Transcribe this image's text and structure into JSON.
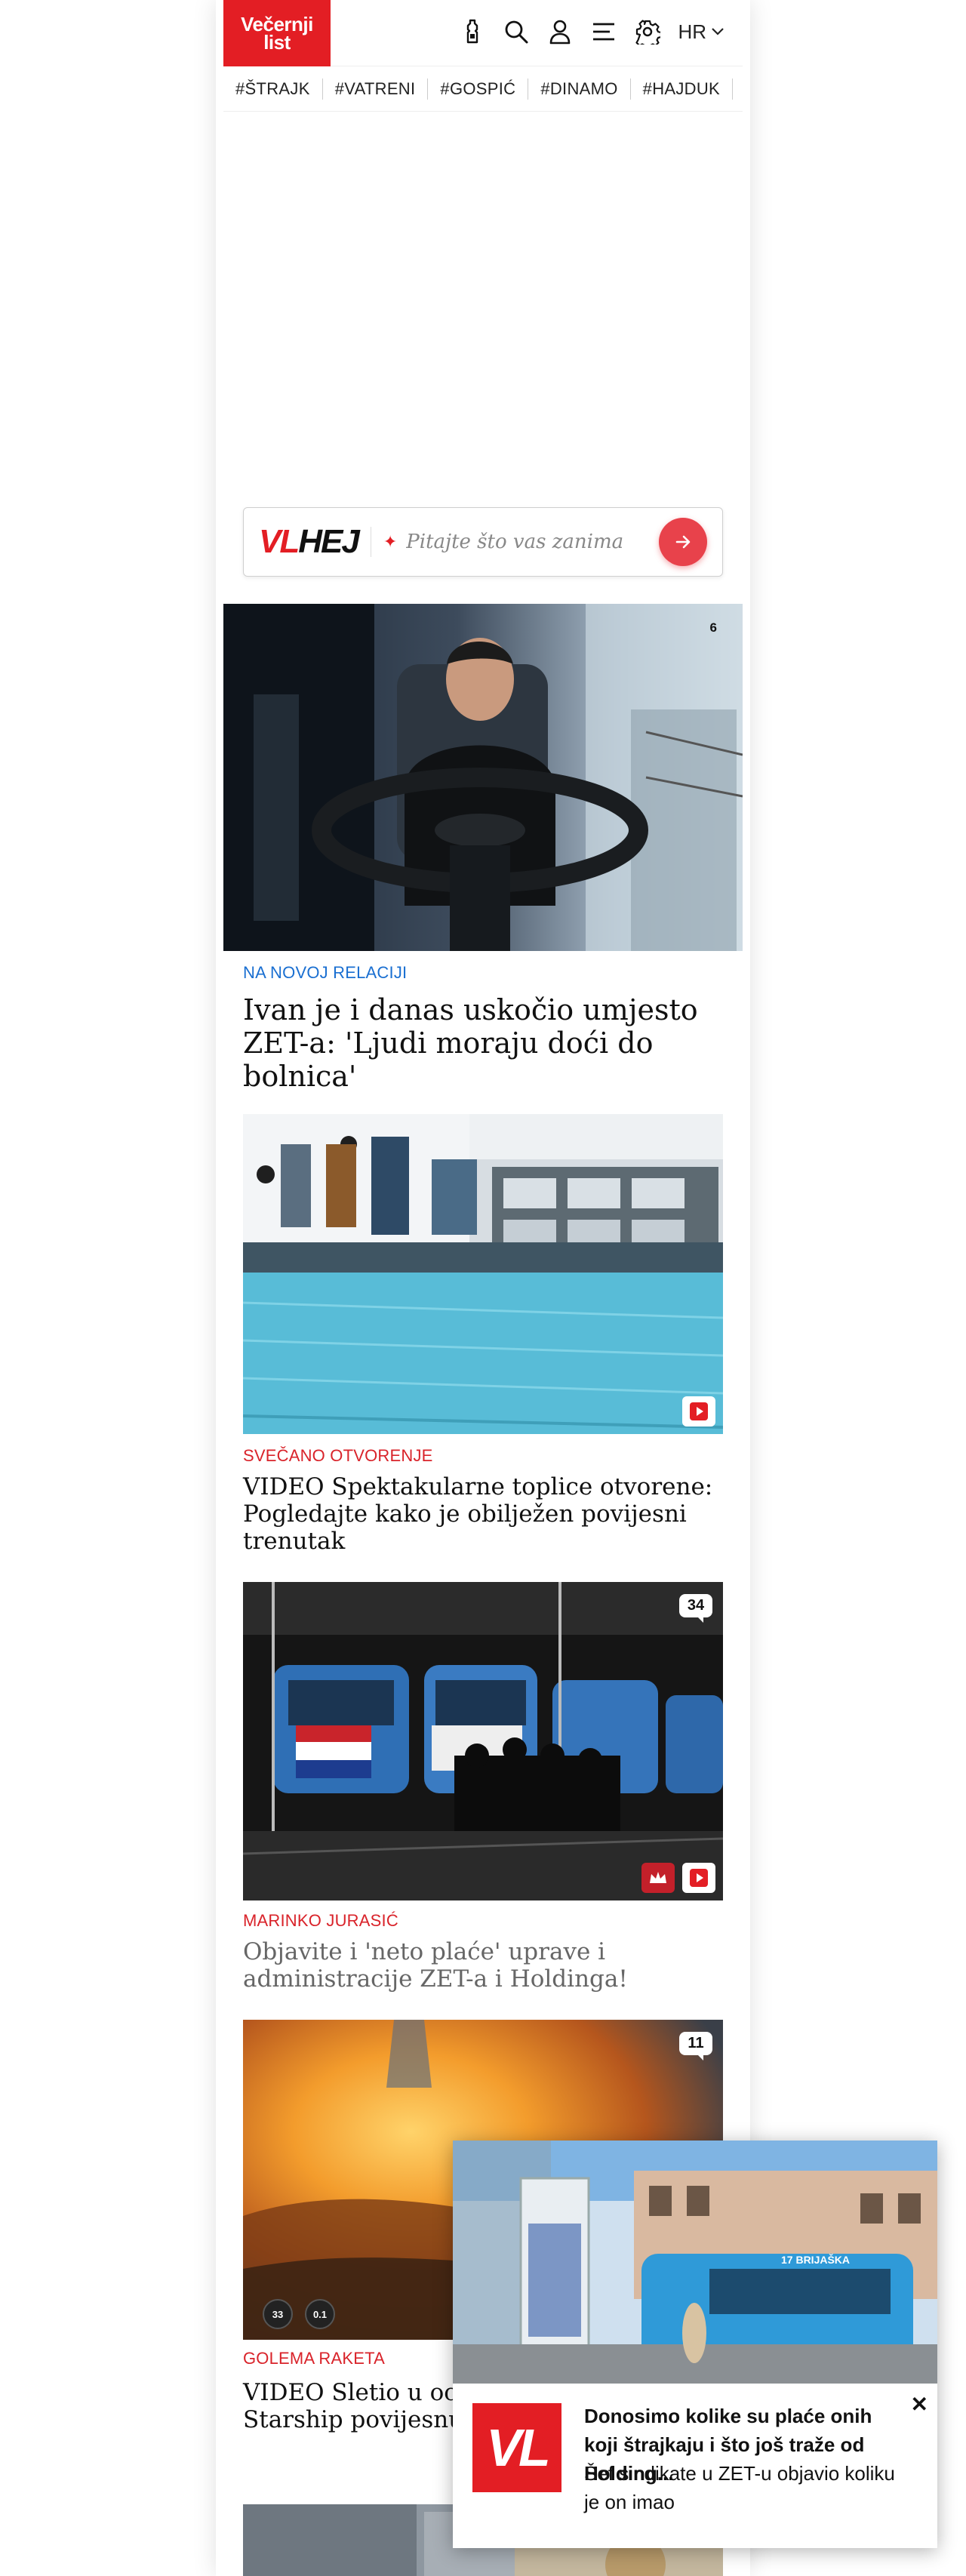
{
  "header": {
    "logo_line1": "Večernji",
    "logo_line2": "list",
    "language": "HR"
  },
  "tags": [
    "#ŠTRAJK",
    "#VATRENI",
    "#GOSPIĆ",
    "#DINAMO",
    "#HAJDUK",
    "#"
  ],
  "vlhej": {
    "logo_vl": "VL",
    "logo_hej": "HEJ",
    "placeholder": "Pitajte što vas zanima"
  },
  "articles": [
    {
      "section": "NA NOVOJ RELACIJI",
      "title": "Ivan je i danas uskočio umjesto ZET-a: 'Ljudi moraju doći do bolnica'",
      "comments": "6"
    },
    {
      "section": "SVEČANO OTVORENJE",
      "title": "VIDEO Spektakularne toplice otvorene: Pogledajte kako je obilježen povijesni trenutak"
    },
    {
      "section": "MARINKO JURASIĆ",
      "title": "Objavite i 'neto plaće' uprave i administracije ZET-a i Holdinga!",
      "comments": "34"
    },
    {
      "section": "GOLEMA RAKETA",
      "title": "VIDEO Sletio u ocean u plamenu: Starship povijesnu misiju",
      "comments": "11",
      "stat1": "33",
      "stat2": "0.1"
    }
  ],
  "popup": {
    "logo": "VL",
    "title": "Donosimo kolike su plaće onih koji štrajkaju i što još traže od Holding...",
    "subtitle": "Šef sindikate u ZET-u objavio koliku je on imao",
    "tram_label": "17 BRIJAŠKA"
  },
  "colors": {
    "brand_red": "#e31e24",
    "section_blue": "#1a6fd1",
    "section_red": "#d9232a"
  }
}
